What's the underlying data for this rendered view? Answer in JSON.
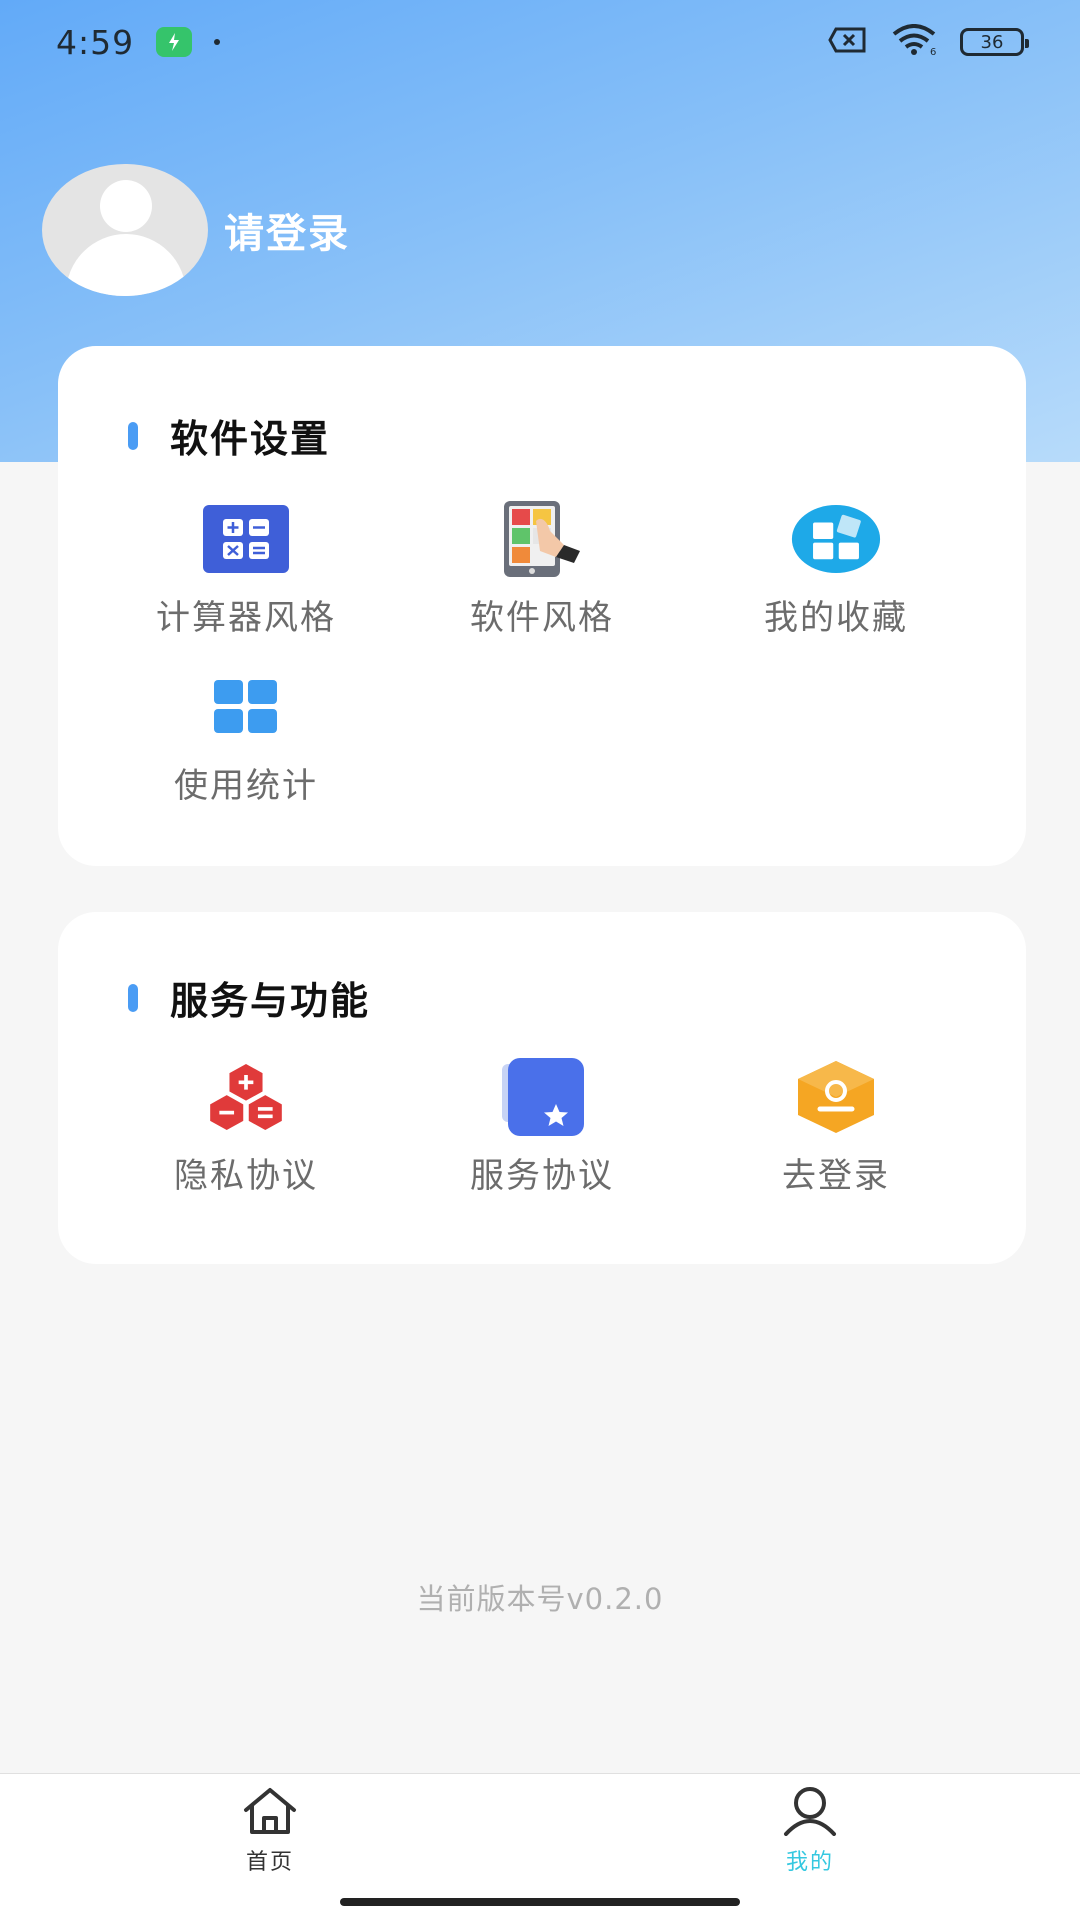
{
  "status_bar": {
    "time": "4:59",
    "battery": "36"
  },
  "profile": {
    "login_text": "请登录"
  },
  "software_settings": {
    "title": "软件设置",
    "items": [
      {
        "label": "计算器风格",
        "icon": "calculator-icon"
      },
      {
        "label": "软件风格",
        "icon": "theme-icon"
      },
      {
        "label": "我的收藏",
        "icon": "favorites-icon"
      },
      {
        "label": "使用统计",
        "icon": "stats-grid-icon"
      }
    ]
  },
  "services": {
    "title": "服务与功能",
    "items": [
      {
        "label": "隐私协议",
        "icon": "privacy-icon"
      },
      {
        "label": "服务协议",
        "icon": "service-book-icon"
      },
      {
        "label": "去登录",
        "icon": "login-badge-icon"
      }
    ]
  },
  "version": "当前版本号v0.2.0",
  "tabbar": {
    "tabs": [
      {
        "label": "首页",
        "active": false
      },
      {
        "label": "我的",
        "active": true
      }
    ],
    "active_color": "#35c8e0",
    "inactive_color": "#333333"
  },
  "colors": {
    "accent": "#4a9cf4",
    "header_gradient_start": "#62aaf8",
    "header_gradient_end": "#b7dbfa"
  }
}
